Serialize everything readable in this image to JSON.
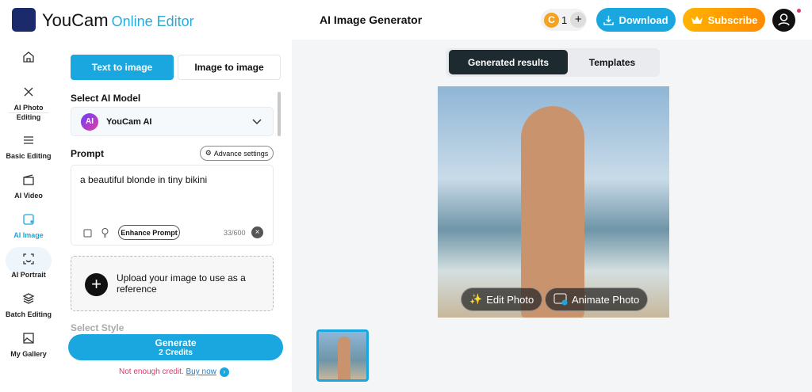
{
  "header": {
    "brand": "YouCam",
    "brand_sub": "Online Editor",
    "title": "AI Image Generator",
    "credits": "1",
    "credits_add": "+",
    "download": "Download",
    "subscribe": "Subscribe"
  },
  "sidebar": {
    "items": [
      {
        "label": "AI Photo Editing"
      },
      {
        "label": "Basic Editing"
      },
      {
        "label": "AI Video"
      },
      {
        "label": "AI Image"
      },
      {
        "label": "AI Portrait"
      },
      {
        "label": "Batch Editing"
      },
      {
        "label": "My Gallery"
      }
    ],
    "active": "AI Image"
  },
  "panel": {
    "tabs": [
      "Text to image",
      "Image to image"
    ],
    "model_label": "Select AI Model",
    "model_badge": "AI",
    "model": "YouCam AI",
    "prompt_label": "Prompt",
    "advance": "Advance settings",
    "prompt": "a beautiful blonde in tiny bikini",
    "enhance": "Enhance Prompt",
    "count": "33/600",
    "upload": "Upload your image to use as a reference",
    "style_label": "Select Style",
    "generate": "Generate",
    "generate_cost": "2 Credits",
    "warn": "Not enough credit.",
    "buy": "Buy now"
  },
  "main": {
    "tabs": [
      "Generated results",
      "Templates"
    ],
    "edit": "Edit Photo",
    "animate": "Animate Photo"
  },
  "colors": {
    "accent": "#1aa7e0",
    "subscribe": "#ffa000",
    "warn": "#e0356a"
  }
}
